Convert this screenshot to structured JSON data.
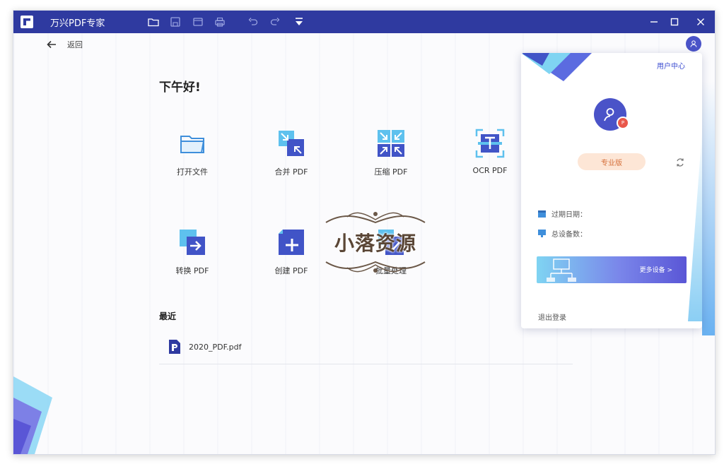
{
  "app": {
    "title": "万兴PDF专家"
  },
  "nav": {
    "back_label": "返回"
  },
  "home": {
    "greeting": "下午好!",
    "tools": [
      {
        "label": "打开文件",
        "icon": "folder-icon"
      },
      {
        "label": "合并 PDF",
        "icon": "merge-icon"
      },
      {
        "label": "压缩 PDF",
        "icon": "compress-icon"
      },
      {
        "label": "OCR PDF",
        "icon": "ocr-icon"
      },
      {
        "label": "转换 PDF",
        "icon": "convert-icon"
      },
      {
        "label": "创建 PDF",
        "icon": "create-icon"
      },
      {
        "label": "批量处理",
        "icon": "batch-icon"
      }
    ],
    "recent_title": "最近",
    "recent_files": [
      {
        "name": "2020_PDF.pdf"
      }
    ]
  },
  "user_panel": {
    "link_label": "用户中心",
    "badge_letter": "P",
    "plan_label": "专业版",
    "expire_label": "过期日期：",
    "devices_label": "总设备数：",
    "more_devices_label": "更多设备 >",
    "logout_label": "退出登录"
  },
  "watermark": {
    "text": "小落资源"
  },
  "colors": {
    "titlebar": "#2f3aa0",
    "accent": "#4a53c8",
    "link": "#3a4bd0",
    "pro_badge_bg": "#fde6d6",
    "pro_badge_text": "#d5703b"
  }
}
